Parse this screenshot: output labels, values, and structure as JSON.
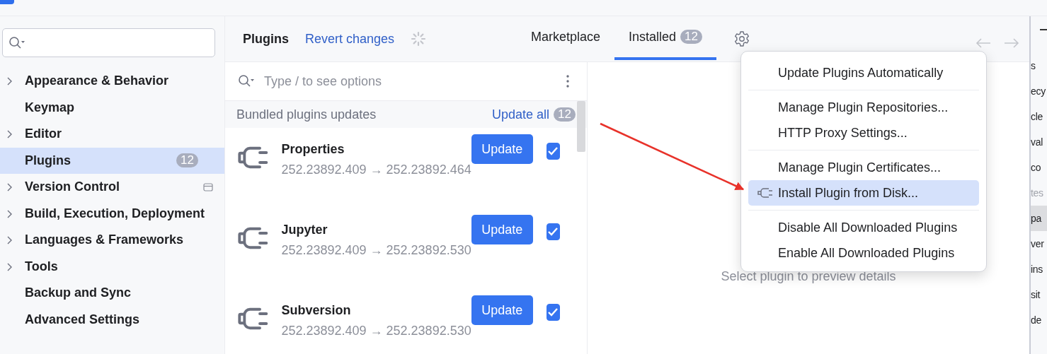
{
  "sidebar": {
    "items": [
      {
        "label": "Appearance & Behavior",
        "kind": "group",
        "expanded": false,
        "selected": false,
        "project_scoped": false
      },
      {
        "label": "Keymap",
        "kind": "page",
        "selected": false,
        "project_scoped": false
      },
      {
        "label": "Editor",
        "kind": "group",
        "expanded": false,
        "selected": false,
        "project_scoped": false
      },
      {
        "label": "Plugins",
        "kind": "page",
        "selected": true,
        "badge": "12",
        "project_scoped": false
      },
      {
        "label": "Version Control",
        "kind": "group",
        "expanded": false,
        "selected": false,
        "project_scoped": true
      },
      {
        "label": "Build, Execution, Deployment",
        "kind": "group",
        "expanded": false,
        "selected": false,
        "project_scoped": false
      },
      {
        "label": "Languages & Frameworks",
        "kind": "group",
        "expanded": false,
        "selected": false,
        "project_scoped": false
      },
      {
        "label": "Tools",
        "kind": "group",
        "expanded": false,
        "selected": false,
        "project_scoped": false
      },
      {
        "label": "Backup and Sync",
        "kind": "page",
        "selected": false,
        "project_scoped": false
      },
      {
        "label": "Advanced Settings",
        "kind": "page",
        "selected": false,
        "project_scoped": false
      }
    ]
  },
  "header": {
    "title": "Plugins",
    "revert_link": "Revert changes",
    "tabs": [
      {
        "label": "Marketplace",
        "selected": false
      },
      {
        "label": "Installed",
        "selected": true,
        "badge": "12"
      }
    ]
  },
  "plugin_list": {
    "search": {
      "placeholder": "Type / to see options"
    },
    "section": {
      "title": "Bundled plugins updates",
      "action": "Update all",
      "count": "12"
    },
    "plugins": [
      {
        "name": "Properties",
        "version": "252.23892.409 → 252.23892.464",
        "button": "Update",
        "checked": true
      },
      {
        "name": "Jupyter",
        "version": "252.23892.409 → 252.23892.530",
        "button": "Update",
        "checked": true
      },
      {
        "name": "Subversion",
        "version": "252.23892.409 → 252.23892.530",
        "button": "Update",
        "checked": true
      }
    ]
  },
  "details": {
    "placeholder_text": "Select plugin to preview details"
  },
  "gear_menu": {
    "groups": [
      [
        {
          "label": "Update Plugins Automatically",
          "selected": false,
          "has_icon": false
        }
      ],
      [
        {
          "label": "Manage Plugin Repositories...",
          "selected": false,
          "has_icon": false
        },
        {
          "label": "HTTP Proxy Settings...",
          "selected": false,
          "has_icon": false
        }
      ],
      [
        {
          "label": "Manage Plugin Certificates...",
          "selected": false,
          "has_icon": false
        },
        {
          "label": "Install Plugin from Disk...",
          "selected": true,
          "has_icon": true
        }
      ],
      [
        {
          "label": "Disable All Downloaded Plugins",
          "selected": false,
          "has_icon": false
        },
        {
          "label": "Enable All Downloaded Plugins",
          "selected": false,
          "has_icon": false
        }
      ]
    ]
  },
  "background_window": {
    "lines": [
      {
        "text": "s",
        "selected": false,
        "disabled": false
      },
      {
        "text": "ecy",
        "selected": false,
        "disabled": false
      },
      {
        "text": "cle",
        "selected": false,
        "disabled": false
      },
      {
        "text": "val",
        "selected": false,
        "disabled": false
      },
      {
        "text": "co",
        "selected": false,
        "disabled": false
      },
      {
        "text": "tes",
        "selected": false,
        "disabled": true
      },
      {
        "text": "pa",
        "selected": true,
        "disabled": false
      },
      {
        "text": "ver",
        "selected": false,
        "disabled": false
      },
      {
        "text": "ins",
        "selected": false,
        "disabled": false
      },
      {
        "text": "sit",
        "selected": false,
        "disabled": false
      },
      {
        "text": "de",
        "selected": false,
        "disabled": false
      }
    ]
  }
}
